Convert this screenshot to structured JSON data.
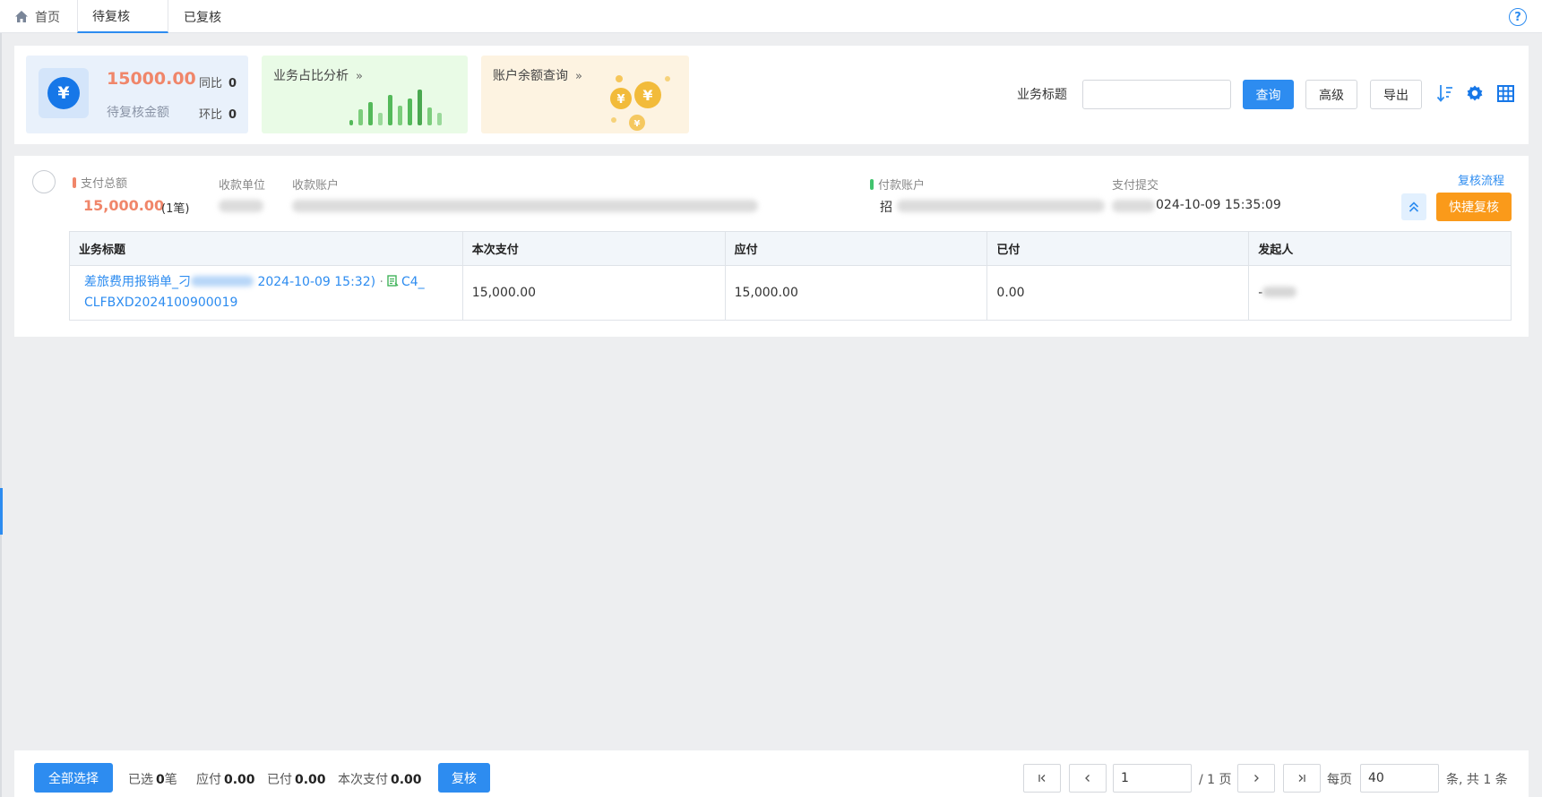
{
  "tabs": {
    "home": "首页",
    "pending": "待复核",
    "reviewed": "已复核",
    "help": "?"
  },
  "summary": {
    "amount": "15000.00",
    "amount_label": "待复核金额",
    "yoy_label": "同比",
    "yoy_value": "0",
    "mom_label": "环比",
    "mom_value": "0",
    "biz_card_title": "业务占比分析",
    "acct_card_title": "账户余额查询",
    "chevron": "»"
  },
  "search": {
    "label": "业务标题",
    "value": "",
    "query_button": "查询",
    "advanced_button": "高级",
    "export_button": "导出"
  },
  "record": {
    "pay_total_label": "支付总额",
    "pay_total_value": "15,000.00",
    "pay_count": "(1笔)",
    "payee_unit_label": "收款单位",
    "payee_account_label": "收款账户",
    "payer_account_label": "付款账户",
    "payer_account_prefix": "招",
    "submit_label": "支付提交",
    "submit_time": "024-10-09 15:35:09",
    "flow_link": "复核流程",
    "quick_review_button": "快捷复核",
    "table": {
      "headers": [
        "业务标题",
        "本次支付",
        "应付",
        "已付",
        "发起人"
      ],
      "row": {
        "title_part1": "差旅费用报销单_刁",
        "title_part2": "2024-10-09 15:32)",
        "title_sep": "·",
        "code_prefix": "C4_",
        "code": "CLFBXD2024100900019",
        "current_pay": "15,000.00",
        "payable": "15,000.00",
        "paid": "0.00",
        "initiator": "-"
      }
    }
  },
  "footer": {
    "select_all_button": "全部选择",
    "selected_label": "已选",
    "selected_count": "0",
    "selected_unit": "笔",
    "payable_label": "应付",
    "payable_value": "0.00",
    "paid_label": "已付",
    "paid_value": "0.00",
    "current_label": "本次支付",
    "current_value": "0.00",
    "review_button": "复核",
    "page_value": "1",
    "page_total": "/ 1 页",
    "per_page_label": "每页",
    "per_page_value": "40",
    "total_text": "条, 共 1 条"
  },
  "colors": {
    "primary": "#2d8cf0",
    "amount": "#f0866a",
    "quick": "#fa9a1a"
  }
}
